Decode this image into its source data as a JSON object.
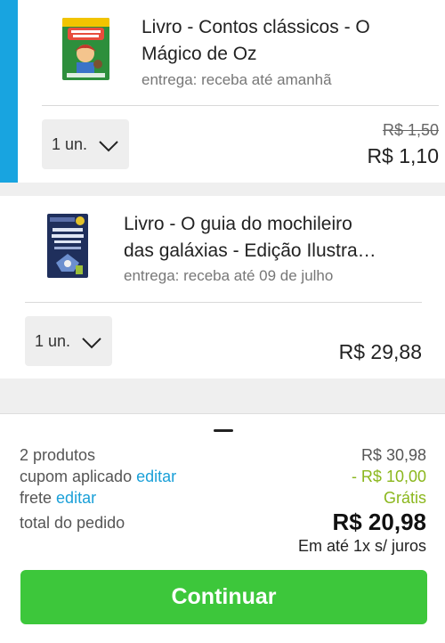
{
  "items": [
    {
      "title_line1": "Livro - Contos clássicos - O",
      "title_line2": "Mágico de Oz",
      "delivery": "entrega: receba até amanhã",
      "quantity": "1 un.",
      "old_price": "R$ 1,50",
      "price": "R$ 1,10"
    },
    {
      "title_line1": "Livro - O guia do mochileiro",
      "title_line2": "das galáxias - Edição Ilustra…",
      "delivery": "entrega: receba até 09 de julho",
      "quantity": "1 un.",
      "price": "R$ 29,88"
    }
  ],
  "summary": {
    "products_label": "2 produtos",
    "products_value": "R$ 30,98",
    "coupon_label": "cupom aplicado",
    "coupon_edit": "editar",
    "coupon_value": "- R$ 10,00",
    "shipping_label": "frete",
    "shipping_edit": "editar",
    "shipping_value": "Grátis",
    "total_label": "total do pedido",
    "total_value": "R$ 20,98",
    "installments": "Em até 1x s/ juros"
  },
  "cta_label": "Continuar",
  "colors": {
    "accent": "#18a4e0",
    "link": "#1aa0d8",
    "discount": "#8bb71d",
    "button": "#3dc73b"
  }
}
